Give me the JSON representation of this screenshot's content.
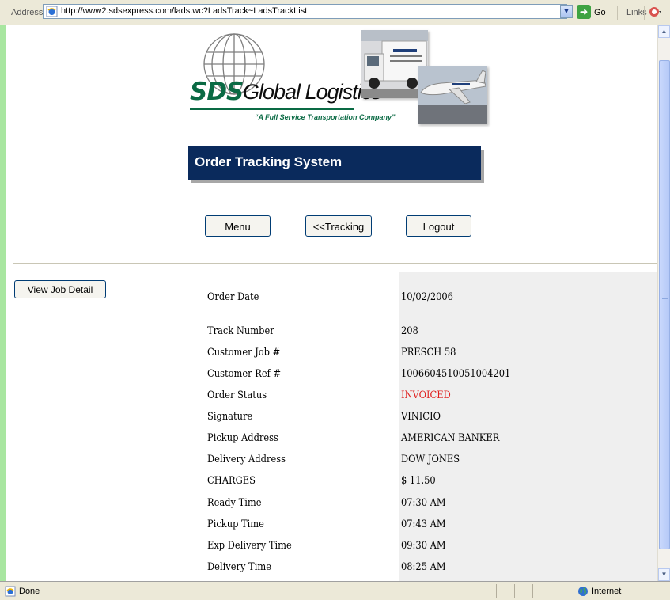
{
  "browser": {
    "address_label": "Address",
    "url": "http://www2.sdsexpress.com/lads.wc?LadsTrack~LadsTrackList",
    "go_label": "Go",
    "links_label": "Links",
    "status_text": "Done",
    "zone_text": "Internet"
  },
  "header": {
    "logo_sds": "SDS",
    "logo_global": "Global Logistics",
    "registered": "®",
    "tagline": "“A Full Service Transportation Company”",
    "title": "Order Tracking System"
  },
  "buttons": {
    "menu": "Menu",
    "tracking": "<<Tracking",
    "logout": "Logout",
    "job_detail": "View Job Detail"
  },
  "details": [
    {
      "label": "Order Date",
      "value": "10/02/2006"
    },
    {
      "label": "Track Number",
      "value": "208"
    },
    {
      "label": "Customer Job #",
      "value": "PRESCH 58"
    },
    {
      "label": "Customer Ref #",
      "value": "1006604510051004201"
    },
    {
      "label": "Order Status",
      "value": "INVOICED"
    },
    {
      "label": "Signature",
      "value": "VINICIO"
    },
    {
      "label": "Pickup Address",
      "value": "AMERICAN BANKER"
    },
    {
      "label": "Delivery Address",
      "value": "DOW JONES"
    },
    {
      "label": "CHARGES",
      "value": "$ 11.50"
    },
    {
      "label": "Ready Time",
      "value": "07:30 AM"
    },
    {
      "label": "Pickup Time",
      "value": "07:43 AM"
    },
    {
      "label": "Exp Delivery Time",
      "value": "09:30 AM"
    },
    {
      "label": "Delivery Time",
      "value": "08:25 AM"
    }
  ],
  "colors": {
    "brand_green": "#0a6a44",
    "banner_navy": "#0a2a5c",
    "status_red": "#e0201f",
    "frame_green": "#a8e6a0"
  }
}
